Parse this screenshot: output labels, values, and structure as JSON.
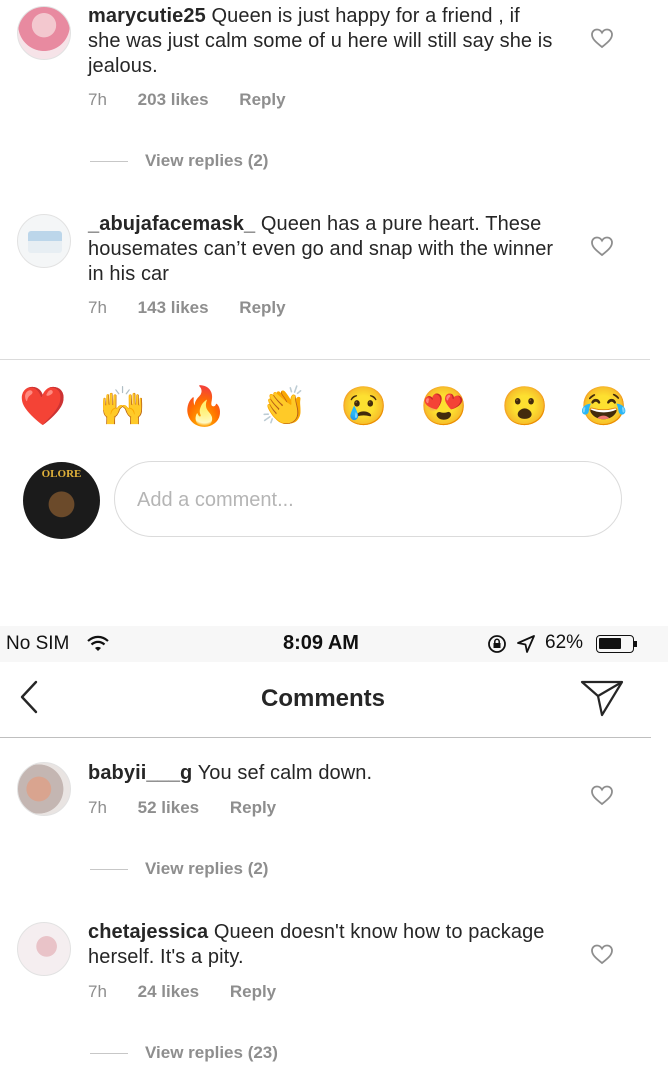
{
  "top_comments": [
    {
      "username": "marycutie25",
      "text": "Queen is just happy for a friend , if she was just calm some of u here will still say she is jealous.",
      "time": "7h",
      "likes": "203 likes",
      "reply": "Reply",
      "view_replies": "View replies (2)"
    },
    {
      "username": "_abujafacemask_",
      "text": "Queen has a pure heart. These housemates can’t even go and snap with the winner in his car",
      "time": "7h",
      "likes": "143 likes",
      "reply": "Reply"
    }
  ],
  "emoji_bar": [
    "❤️",
    "🙌",
    "🔥",
    "👏",
    "😢",
    "😍",
    "😮",
    "😂"
  ],
  "comment_box": {
    "placeholder": "Add a comment..."
  },
  "status_bar": {
    "carrier": "No SIM",
    "time": "8:09 AM",
    "battery": "62%"
  },
  "header": {
    "title": "Comments"
  },
  "bottom_comments": [
    {
      "username": "babyii___g",
      "text": "You sef calm down.",
      "time": "7h",
      "likes": "52 likes",
      "reply": "Reply",
      "view_replies": "View replies (2)"
    },
    {
      "username": "chetajessica",
      "text": "Queen doesn't know how to package herself. It's a pity.",
      "time": "7h",
      "likes": "24 likes",
      "reply": "Reply",
      "view_replies": "View replies (23)"
    }
  ],
  "colors": {
    "text": "#262626",
    "muted": "#8e8e8e",
    "divider": "#dbdbdb",
    "status_bg": "#f7f7f7"
  },
  "icons": [
    "heart-outline-icon",
    "back-chevron-icon",
    "direct-send-icon",
    "wifi-icon",
    "orientation-lock-icon",
    "location-arrow-icon",
    "battery-icon"
  ]
}
